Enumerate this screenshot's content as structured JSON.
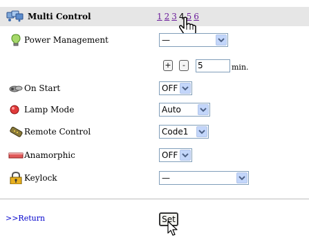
{
  "header": {
    "title": "Multi Control",
    "icon": "multi-control-icon",
    "pages": [
      "1",
      "2",
      "3",
      "4",
      "5",
      "6"
    ],
    "current_page": "4",
    "background": "#e6e6e6"
  },
  "rows": {
    "power_management": {
      "label": "Power Management",
      "icon": "lightbulb-icon",
      "value": "—"
    },
    "power_timer": {
      "plus": "+",
      "minus": "-",
      "minutes": "5",
      "unit": "min."
    },
    "on_start": {
      "label": "On Start",
      "icon": "projector-icon",
      "value": "OFF"
    },
    "lamp_mode": {
      "label": "Lamp Mode",
      "icon": "red-lamp-icon",
      "value": "Auto"
    },
    "remote_control": {
      "label": "Remote Control",
      "icon": "remote-icon",
      "value": "Code1"
    },
    "anamorphic": {
      "label": "Anamorphic",
      "icon": "anamorphic-icon",
      "value": "OFF"
    },
    "keylock": {
      "label": "Keylock",
      "icon": "padlock-icon",
      "value": "—"
    }
  },
  "footer": {
    "return_label": ">>Return",
    "set_label": "Set"
  },
  "colors": {
    "link": "#0000cc",
    "visited_link": "#6a1b9a",
    "select_border": "#7f9db9",
    "select_arrow": "#c3d6fa"
  }
}
